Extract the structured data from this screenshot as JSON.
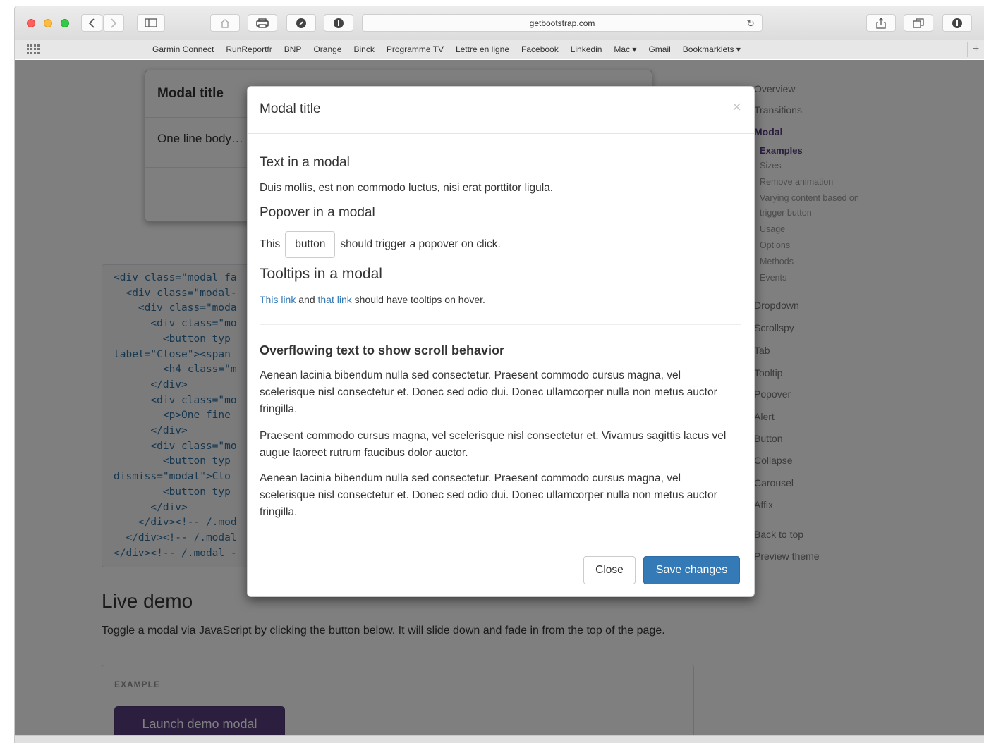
{
  "browser": {
    "url": "getbootstrap.com",
    "icons": {
      "back": "chevron-left-icon",
      "forward": "chevron-right-icon",
      "sidebar": "sidebar-icon",
      "home": "home-icon",
      "print": "printer-icon",
      "reload": "reload-icon",
      "share": "share-icon",
      "tabs": "tabs-icon"
    },
    "bookmarks": [
      "Garmin Connect",
      "RunReportfr",
      "BNP",
      "Orange",
      "Binck",
      "Programme TV",
      "Lettre en ligne",
      "Facebook",
      "Linkedin",
      "Mac ▾",
      "Gmail",
      "Bookmarklets ▾"
    ]
  },
  "background_page": {
    "bg_modal_title": "Modal title",
    "bg_modal_body": "One line body…",
    "code_lines": [
      "<div class=\"modal fa",
      "  <div class=\"modal-",
      "    <div class=\"moda",
      "      <div class=\"mo",
      "        <button typ",
      "label=\"Close\"><span",
      "        <h4 class=\"m",
      "      </div>",
      "      <div class=\"mo",
      "        <p>One fine",
      "      </div>",
      "      <div class=\"mo",
      "        <button typ",
      "dismiss=\"modal\">Clo",
      "        <button typ",
      "      </div>",
      "    </div><!-- /.mod",
      "  </div><!-- /.modal",
      "</div><!-- /.modal -"
    ],
    "live_demo_heading": "Live demo",
    "live_demo_desc": "Toggle a modal via JavaScript by clicking the button below. It will slide down and fade in from the top of the page.",
    "example_label": "EXAMPLE",
    "launch_button": "Launch demo modal"
  },
  "docs_nav": {
    "items": [
      {
        "label": "Overview",
        "active": false
      },
      {
        "label": "Transitions",
        "active": false
      },
      {
        "label": "Modal",
        "active": true
      },
      {
        "label": "Dropdown",
        "active": false
      },
      {
        "label": "Scrollspy",
        "active": false
      },
      {
        "label": "Tab",
        "active": false
      },
      {
        "label": "Tooltip",
        "active": false
      },
      {
        "label": "Popover",
        "active": false
      },
      {
        "label": "Alert",
        "active": false
      },
      {
        "label": "Button",
        "active": false
      },
      {
        "label": "Collapse",
        "active": false
      },
      {
        "label": "Carousel",
        "active": false
      },
      {
        "label": "Affix",
        "active": false
      },
      {
        "label": "Back to top",
        "active": false
      },
      {
        "label": "Preview theme",
        "active": false
      }
    ],
    "sub_items": [
      {
        "label": "Examples",
        "active": true
      },
      {
        "label": "Sizes",
        "active": false
      },
      {
        "label": "Remove animation",
        "active": false
      },
      {
        "label": "Varying content based on",
        "active": false
      },
      {
        "label": "trigger button",
        "active": false
      },
      {
        "label": "Usage",
        "active": false
      },
      {
        "label": "Options",
        "active": false
      },
      {
        "label": "Methods",
        "active": false
      },
      {
        "label": "Events",
        "active": false
      }
    ]
  },
  "modal": {
    "title": "Modal title",
    "close_glyph": "×",
    "text_heading": "Text in a modal",
    "text_body": "Duis mollis, est non commodo luctus, nisi erat porttitor ligula.",
    "popover_heading": "Popover in a modal",
    "popover_pre": "This",
    "popover_button": "button",
    "popover_post": "should trigger a popover on click.",
    "tooltips_heading": "Tooltips in a modal",
    "tooltip_link1": "This link",
    "tooltip_mid": "and",
    "tooltip_link2": "that link",
    "tooltip_post": "should have tooltips on hover.",
    "overflow_heading": "Overflowing text to show scroll behavior",
    "overflow_p1": "Aenean lacinia bibendum nulla sed consectetur. Praesent commodo cursus magna, vel scelerisque nisl consectetur et. Donec sed odio dui. Donec ullamcorper nulla non metus auctor fringilla.",
    "overflow_p2": "Praesent commodo cursus magna, vel scelerisque nisl consectetur et. Vivamus sagittis lacus vel augue laoreet rutrum faucibus dolor auctor.",
    "overflow_p3": "Aenean lacinia bibendum nulla sed consectetur. Praesent commodo cursus magna, vel scelerisque nisl consectetur et. Donec sed odio dui. Donec ullamcorper nulla non metus auctor fringilla.",
    "close_button": "Close",
    "save_button": "Save changes"
  },
  "colors": {
    "primary": "#337ab7",
    "bootstrap_purple": "#563d7c",
    "backdrop": "#000000"
  }
}
